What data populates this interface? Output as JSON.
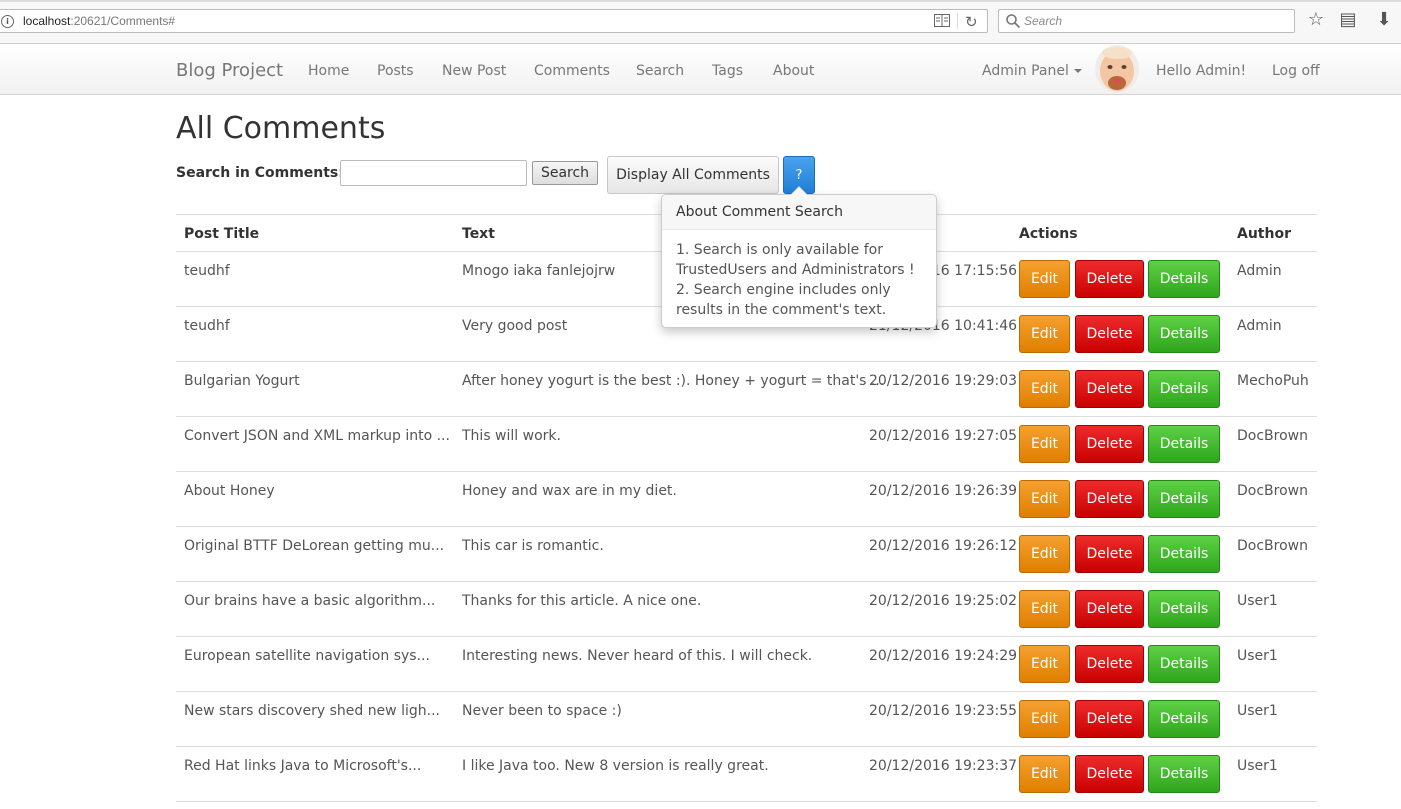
{
  "browser": {
    "url_host": "localhost",
    "url_rest": ":20621/Comments#",
    "search_placeholder": "Search",
    "icons": [
      "info-icon",
      "reader-view-icon",
      "reload-icon",
      "search-icon",
      "bookmark-star-icon",
      "reading-list-icon",
      "download-icon"
    ]
  },
  "nav": {
    "brand": "Blog Project",
    "links": [
      "Home",
      "Posts",
      "New Post",
      "Comments",
      "Search",
      "Tags",
      "About"
    ],
    "admin_panel": "Admin Panel",
    "greeting": "Hello Admin!",
    "logoff": "Log off"
  },
  "page": {
    "title": "All Comments",
    "search_label": "Search in Comments:",
    "search_value": "",
    "search_button": "Search",
    "display_all_button": "Display All Comments",
    "help_button": "?"
  },
  "popover": {
    "title": "About Comment Search",
    "line1": "1. Search is only available for TrustedUsers and Administrators !",
    "line2": "2. Search engine includes only results in the comment's text."
  },
  "table": {
    "headers": {
      "post_title": "Post Title",
      "text": "Text",
      "actions": "Actions",
      "author": "Author"
    },
    "buttons": {
      "edit": "Edit",
      "delete": "Delete",
      "details": "Details"
    },
    "rows": [
      {
        "post": "teudhf",
        "text": "Mnogo iaka fanlejojrw",
        "date": "20/12/2016 17:15:56",
        "author": "Admin"
      },
      {
        "post": "teudhf",
        "text": "Very good post",
        "date": "21/12/2016 10:41:46",
        "author": "Admin"
      },
      {
        "post": "Bulgarian Yogurt",
        "text": "After honey yogurt is the best :). Honey + yogurt = that's ...",
        "date": "20/12/2016 19:29:03",
        "author": "MechoPuh"
      },
      {
        "post": "Convert JSON and XML markup into ...",
        "text": "This will work.",
        "date": "20/12/2016 19:27:05",
        "author": "DocBrown"
      },
      {
        "post": "About Honey",
        "text": "Honey and wax are in my diet.",
        "date": "20/12/2016 19:26:39",
        "author": "DocBrown"
      },
      {
        "post": "Original BTTF DeLorean getting mu...",
        "text": "This car is romantic.",
        "date": "20/12/2016 19:26:12",
        "author": "DocBrown"
      },
      {
        "post": "Our brains have a basic algorithm...",
        "text": "Thanks for this article. A nice one.",
        "date": "20/12/2016 19:25:02",
        "author": "User1"
      },
      {
        "post": "European satellite navigation sys...",
        "text": "Interesting news. Never heard of this. I will check.",
        "date": "20/12/2016 19:24:29",
        "author": "User1"
      },
      {
        "post": "New stars discovery shed new ligh...",
        "text": "Never been to space :)",
        "date": "20/12/2016 19:23:55",
        "author": "User1"
      },
      {
        "post": "Red Hat links Java to Microsoft's...",
        "text": "I like Java too. New 8 version is really great.",
        "date": "20/12/2016 19:23:37",
        "author": "User1"
      }
    ]
  },
  "colors": {
    "edit": "#e58600",
    "delete": "#d40000",
    "details": "#36b022",
    "help": "#2a8be0"
  }
}
